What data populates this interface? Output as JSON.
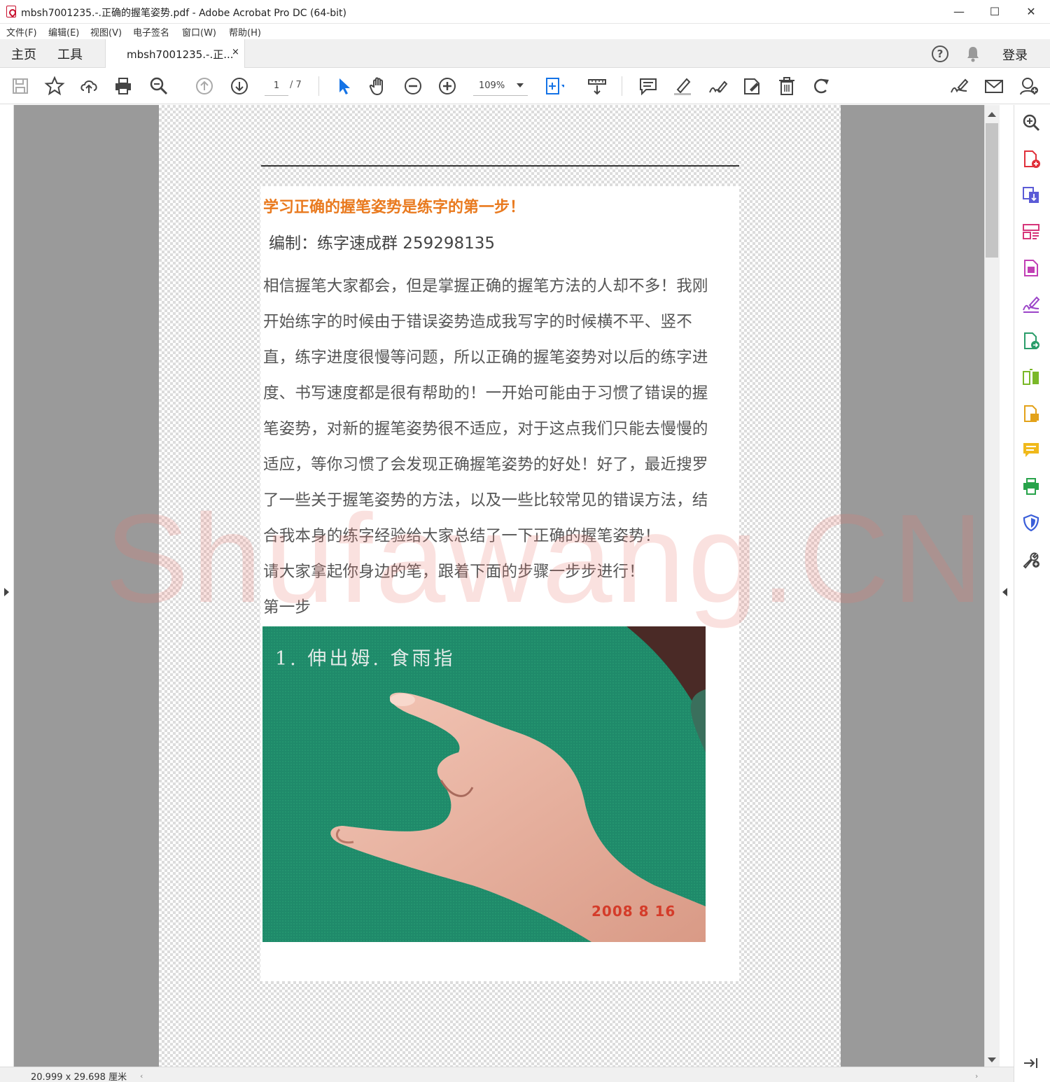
{
  "window": {
    "title": "mbsh7001235.-.正确的握笔姿势.pdf - Adobe Acrobat Pro DC (64-bit)",
    "minimize": "—",
    "maximize": "☐",
    "close": "✕"
  },
  "menu": [
    "文件(F)",
    "编辑(E)",
    "视图(V)",
    "电子签名",
    "窗口(W)",
    "帮助(H)"
  ],
  "tabs": {
    "home": "主页",
    "tools": "工具",
    "document": "mbsh7001235.-.正...",
    "close": "×",
    "login": "登录",
    "help": "?"
  },
  "toolbar": {
    "page_current": "1",
    "page_total": "/ 7",
    "zoom": "109%",
    "icons": [
      "save-icon",
      "bookmark-star-icon",
      "upload-cloud-icon",
      "print-icon",
      "zoom-search-icon",
      "page-up-icon",
      "page-down-icon",
      "select-arrow-icon",
      "hand-icon",
      "zoom-out-icon",
      "zoom-in-icon",
      "fit-page-icon",
      "measure-icon",
      "comment-icon",
      "highlight-pen-icon",
      "sign-icon",
      "edit-text-icon",
      "delete-icon",
      "rotate-icon",
      "fill-sign-icon",
      "email-icon",
      "share-user-icon"
    ]
  },
  "document": {
    "heading": "学习正确的握笔姿势是练字的第一步！",
    "editor_line": "编制：练字速成群 259298135",
    "paragraph_lines": [
      "相信握笔大家都会，但是掌握正确的握笔方法的人却不多！我刚",
      "开始练字的时候由于错误姿势造成我写字的时候横不平、竖不",
      "直，练字进度很慢等问题，所以正确的握笔姿势对以后的练字进",
      "度、书写速度都是很有帮助的！一开始可能由于习惯了错误的握",
      "笔姿势，对新的握笔姿势很不适应，对于这点我们只能去慢慢的",
      "适应，等你习惯了会发现正确握笔姿势的好处！好了，最近搜罗",
      "了一些关于握笔姿势的方法，以及一些比较常见的错误方法，结",
      "合我本身的练字经验给大家总结了一下正确的握笔姿势！",
      "请大家拿起你身边的笔，跟着下面的步骤一步步进行！",
      "第一步"
    ],
    "photo_caption": "1. 伸出姆. 食雨指",
    "photo_date": "2008    8  16",
    "watermark": "Shufawang.CN"
  },
  "status": {
    "page_size": "20.999 x 29.698 厘米"
  },
  "colors": {
    "heading": "#e97a1f",
    "accent_blue": "#1473e6",
    "photo_green": "#1f8a6a"
  }
}
